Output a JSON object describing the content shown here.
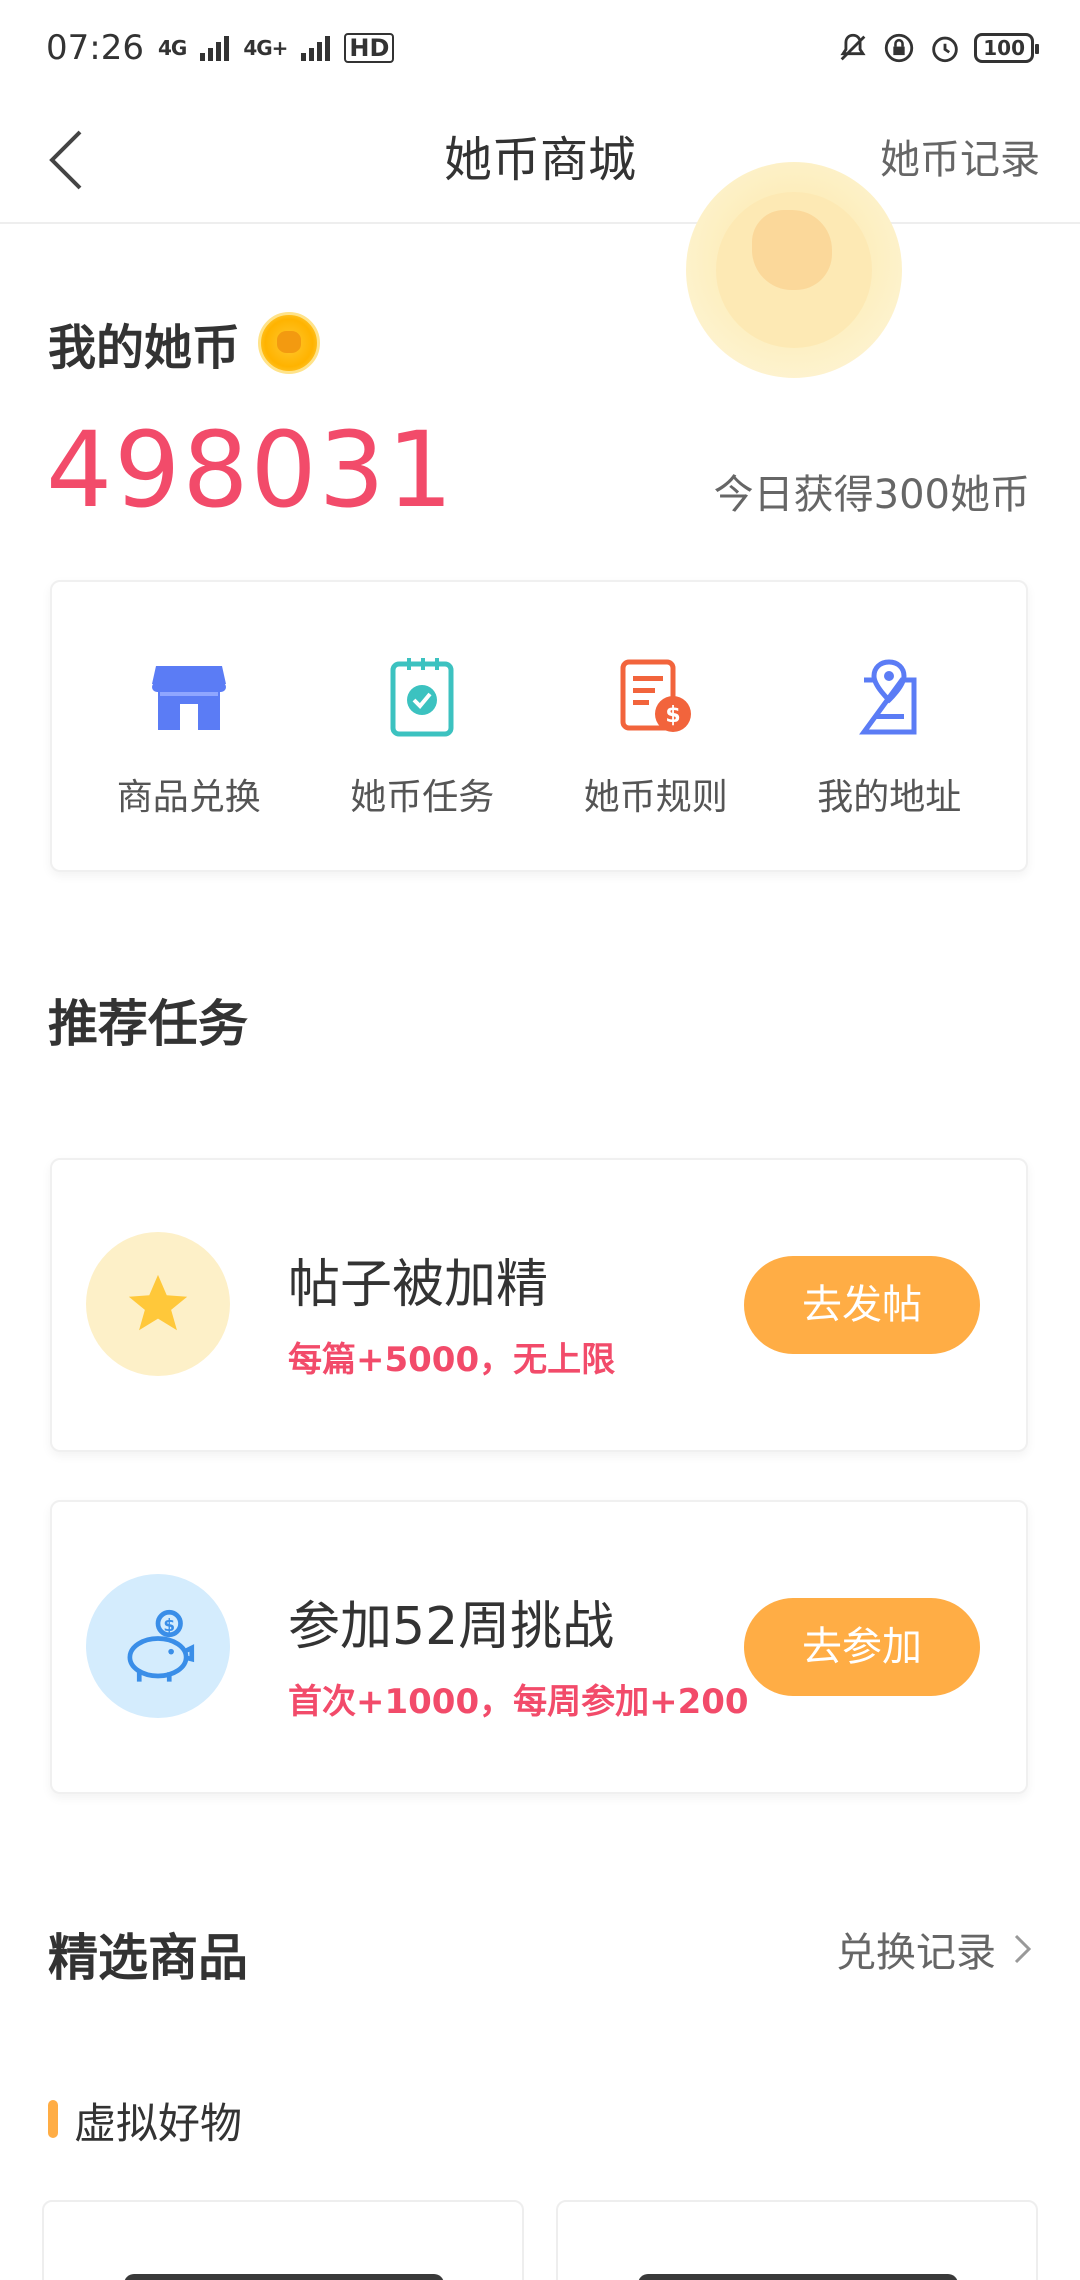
{
  "status_bar": {
    "time": "07:26",
    "net1": "4G",
    "net2": "4G+",
    "hd": "HD",
    "battery": "100"
  },
  "nav": {
    "title": "她币商城",
    "action": "她币记录"
  },
  "balance": {
    "title": "我的她币",
    "value": "498031",
    "today": "今日获得300她币"
  },
  "menu": {
    "items": [
      {
        "label": "商品兑换",
        "icon": "store-icon"
      },
      {
        "label": "她币任务",
        "icon": "task-clipboard-icon"
      },
      {
        "label": "她币规则",
        "icon": "rules-document-icon"
      },
      {
        "label": "我的地址",
        "icon": "address-location-icon"
      }
    ]
  },
  "recommended": {
    "title": "推荐任务",
    "tasks": [
      {
        "title": "帖子被加精",
        "desc": "每篇+5000，无上限",
        "button": "去发帖",
        "icon": "star-icon"
      },
      {
        "title": "参加52周挑战",
        "desc": "首次+1000，每周参加+200",
        "button": "去参加",
        "icon": "piggy-bank-icon"
      }
    ]
  },
  "featured": {
    "title": "精选商品",
    "link": "兑换记录",
    "category": "虚拟好物"
  },
  "colors": {
    "accent_pink": "#f24b6a",
    "accent_orange": "#ffad45",
    "menu_blue": "#5b7cf5",
    "menu_teal": "#3cc2c0",
    "menu_red": "#f2643c"
  }
}
